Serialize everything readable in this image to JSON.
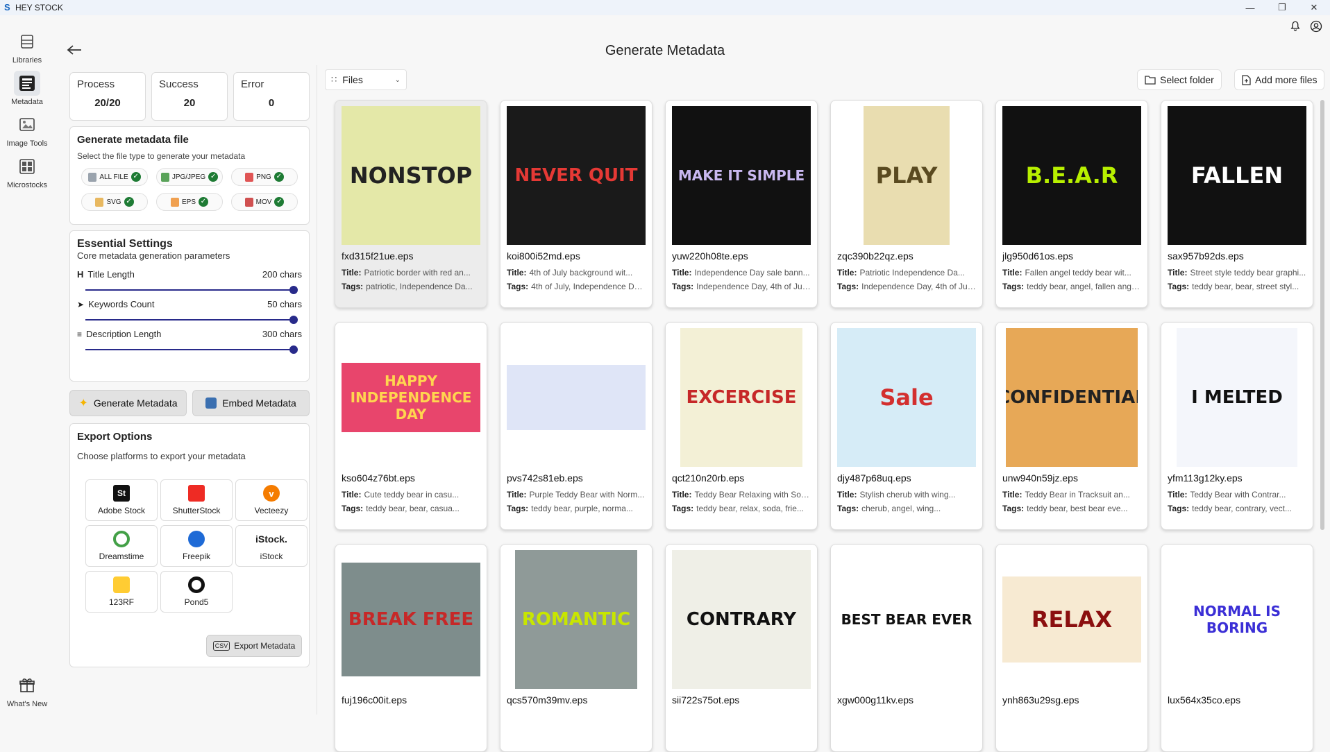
{
  "app": {
    "name": "HEY STOCK"
  },
  "nav": [
    {
      "label": "Libraries",
      "icon": "libraries-icon"
    },
    {
      "label": "Metadata",
      "icon": "metadata-icon"
    },
    {
      "label": "Image Tools",
      "icon": "image-tools-icon"
    },
    {
      "label": "Microstocks",
      "icon": "microstocks-icon"
    },
    {
      "label": "What's New",
      "icon": "gift-icon"
    }
  ],
  "page_title": "Generate Metadata",
  "stats": [
    {
      "label": "Process",
      "value": "20/20"
    },
    {
      "label": "Success",
      "value": "20"
    },
    {
      "label": "Error",
      "value": "0"
    }
  ],
  "generate_file": {
    "title": "Generate metadata file",
    "subtitle": "Select the file type to generate your metadata",
    "types": [
      "ALL FILE",
      "JPG/JPEG",
      "PNG",
      "SVG",
      "EPS",
      "MOV"
    ]
  },
  "settings": {
    "title": "Essential Settings",
    "subtitle": "Core metadata generation parameters",
    "title_length": {
      "label": "Title Length",
      "value": "200 chars",
      "level": 1.0
    },
    "keywords_count": {
      "label": "Keywords Count",
      "value": "50 chars",
      "level": 1.0
    },
    "description_length": {
      "label": "Description Length",
      "value": "300 chars",
      "level": 1.0
    }
  },
  "actions": {
    "generate": "Generate Metadata",
    "embed": "Embed Metadata"
  },
  "export": {
    "title": "Export Options",
    "subtitle": "Choose platforms to export your metadata",
    "platforms": [
      "Adobe Stock",
      "ShutterStock",
      "Vecteezy",
      "Dreamstime",
      "Freepik",
      "iStock",
      "123RF",
      "Pond5"
    ],
    "button": "Export Metadata"
  },
  "toolbar": {
    "files": "Files",
    "select_folder": "Select folder",
    "add_more": "Add more files"
  },
  "labels": {
    "title": "Title:",
    "tags": "Tags:"
  },
  "files": [
    {
      "name": "fxd315f21ue.eps",
      "title": "Patriotic border with red an...",
      "tags": "patriotic, Independence Da...",
      "art": "NONSTOP",
      "bg": "#e4e8a8",
      "fg": "#222"
    },
    {
      "name": "koi800i52md.eps",
      "title": "4th of July background wit...",
      "tags": "4th of July, Independence Da...",
      "art": "NEVER QUIT",
      "bg": "#1a1a1a",
      "fg": "#e53935"
    },
    {
      "name": "yuw220h08te.eps",
      "title": "Independence Day sale bann...",
      "tags": "Independence Day, 4th of Jul...",
      "art": "MAKE IT SIMPLE",
      "bg": "#111111",
      "fg": "#c9b8f0"
    },
    {
      "name": "zqc390b22qz.eps",
      "title": "Patriotic Independence Da...",
      "tags": "Independence Day, 4th of Jul...",
      "art": "PLAY",
      "bg": "#e9ddb0",
      "fg": "#5a4a20"
    },
    {
      "name": "jlg950d61os.eps",
      "title": "Fallen angel teddy bear wit...",
      "tags": "teddy bear, angel, fallen ange...",
      "art": "B.E.A.R",
      "bg": "#111111",
      "fg": "#b8f000"
    },
    {
      "name": "sax957b92ds.eps",
      "title": "Street style teddy bear graphi...",
      "tags": "teddy bear, bear, street styl...",
      "art": "FALLEN",
      "bg": "#111111",
      "fg": "#ffffff"
    },
    {
      "name": "kso604z76bt.eps",
      "title": "Cute teddy bear in casu...",
      "tags": "teddy bear, bear, casua...",
      "art": "HAPPY INDEPENDENCE DAY",
      "bg": "#e8456c",
      "fg": "#ffd54f"
    },
    {
      "name": "pvs742s81eb.eps",
      "title": "Purple Teddy Bear with Norm...",
      "tags": "teddy bear, purple, norma...",
      "art": "",
      "bg": "#dfe5f7",
      "fg": "#d32f2f"
    },
    {
      "name": "qct210n20rb.eps",
      "title": "Teddy Bear Relaxing with Sod...",
      "tags": "teddy bear, relax, soda, frie...",
      "art": "EXCERCISE",
      "bg": "#f3f0d6",
      "fg": "#c62828"
    },
    {
      "name": "djy487p68uq.eps",
      "title": "Stylish cherub with wing...",
      "tags": "cherub, angel, wing...",
      "art": "Sale",
      "bg": "#d6ecf7",
      "fg": "#d32f2f"
    },
    {
      "name": "unw940n59jz.eps",
      "title": "Teddy Bear in Tracksuit an...",
      "tags": "teddy bear, best bear eve...",
      "art": "CONFIDENTIAL",
      "bg": "#e7a857",
      "fg": "#222"
    },
    {
      "name": "yfm113g12ky.eps",
      "title": "Teddy Bear with Contrar...",
      "tags": "teddy bear, contrary, vect...",
      "art": "I MELTED",
      "bg": "#f4f6fb",
      "fg": "#111"
    },
    {
      "name": "fuj196c00it.eps",
      "title": "",
      "tags": "",
      "art": "BREAK FREE",
      "bg": "#7e8d8c",
      "fg": "#c62828"
    },
    {
      "name": "qcs570m39mv.eps",
      "title": "",
      "tags": "",
      "art": "ROMANTIC",
      "bg": "#8f9a98",
      "fg": "#c8e600"
    },
    {
      "name": "sii722s75ot.eps",
      "title": "",
      "tags": "",
      "art": "CONTRARY",
      "bg": "#efefe7",
      "fg": "#111"
    },
    {
      "name": "xgw000g11kv.eps",
      "title": "",
      "tags": "",
      "art": "BEST BEAR EVER",
      "bg": "#ffffff",
      "fg": "#111"
    },
    {
      "name": "ynh863u29sg.eps",
      "title": "",
      "tags": "",
      "art": "RELAX",
      "bg": "#f7ead2",
      "fg": "#8b0f0f"
    },
    {
      "name": "lux564x35co.eps",
      "title": "",
      "tags": "",
      "art": "NORMAL IS BORING",
      "bg": "#ffffff",
      "fg": "#3b2fd6"
    }
  ]
}
